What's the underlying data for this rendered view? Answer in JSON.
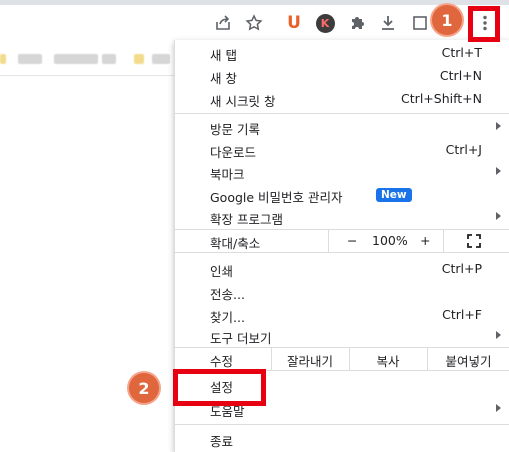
{
  "toolbar": {
    "icons": [
      "share-icon",
      "star-icon",
      "extension-u-icon",
      "extension-k-icon",
      "puzzle-icon",
      "download-icon",
      "window-icon",
      "kebab-menu-icon"
    ],
    "ext_u_letter": "U",
    "ext_k_letter": "K",
    "accent_u": "#e8632a"
  },
  "menu": {
    "new_tab": {
      "label": "새 탭",
      "shortcut": "Ctrl+T"
    },
    "new_window": {
      "label": "새 창",
      "shortcut": "Ctrl+N"
    },
    "incognito": {
      "label": "새 시크릿 창",
      "shortcut": "Ctrl+Shift+N"
    },
    "history": {
      "label": "방문 기록"
    },
    "downloads": {
      "label": "다운로드",
      "shortcut": "Ctrl+J"
    },
    "bookmarks": {
      "label": "북마크"
    },
    "password_manager": {
      "label": "Google 비밀번호 관리자",
      "badge": "New"
    },
    "extensions": {
      "label": "확장 프로그램"
    },
    "zoom": {
      "label": "확대/축소",
      "minus": "−",
      "value": "100%",
      "plus": "+"
    },
    "print": {
      "label": "인쇄",
      "shortcut": "Ctrl+P"
    },
    "cast": {
      "label": "전송..."
    },
    "find": {
      "label": "찾기...",
      "shortcut": "Ctrl+F"
    },
    "more_tools": {
      "label": "도구 더보기"
    },
    "edit": {
      "label": "수정",
      "cut": "잘라내기",
      "copy": "복사",
      "paste": "붙여넣기"
    },
    "settings": {
      "label": "설정"
    },
    "help": {
      "label": "도움말"
    },
    "exit": {
      "label": "종료"
    }
  },
  "annotations": {
    "step1": "1",
    "step2": "2",
    "color_box": "#e60012",
    "color_circle": "#e0663e"
  },
  "accent": "#1a73e8"
}
